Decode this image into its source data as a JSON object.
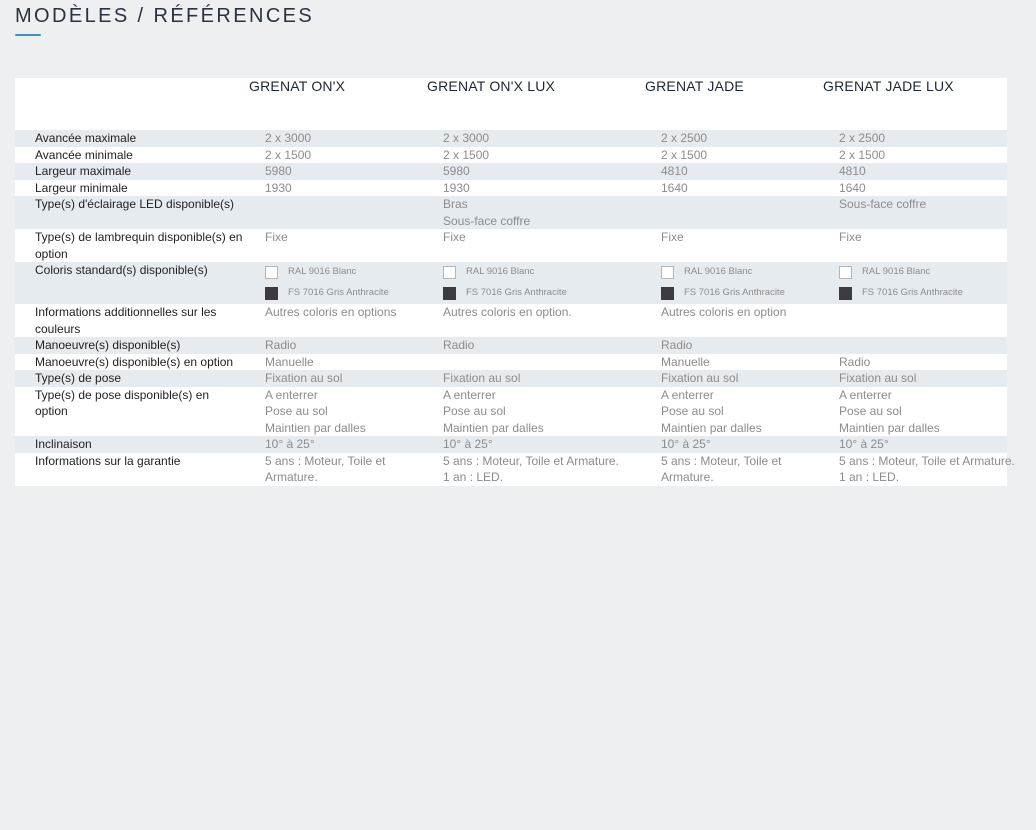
{
  "page": {
    "title": "MODÈLES / RÉFÉRENCES"
  },
  "table": {
    "headers": [
      "",
      "GRENAT ON'X",
      "GRENAT ON'X LUX",
      "GRENAT JADE",
      "GRENAT JADE LUX"
    ],
    "rows": [
      {
        "label": "Avancée maximale",
        "values": [
          [
            "2 x 3000"
          ],
          [
            "2 x 3000"
          ],
          [
            "2 x 2500"
          ],
          [
            "2 x 2500"
          ]
        ]
      },
      {
        "label": "Avancée minimale",
        "values": [
          [
            "2 x 1500"
          ],
          [
            "2 x 1500"
          ],
          [
            "2 x 1500"
          ],
          [
            "2 x 1500"
          ]
        ]
      },
      {
        "label": "Largeur maximale",
        "values": [
          [
            "5980"
          ],
          [
            "5980"
          ],
          [
            "4810"
          ],
          [
            "4810"
          ]
        ]
      },
      {
        "label": "Largeur minimale",
        "values": [
          [
            "1930"
          ],
          [
            "1930"
          ],
          [
            "1640"
          ],
          [
            "1640"
          ]
        ]
      },
      {
        "label": "Type(s) d'éclairage LED disponible(s)",
        "values": [
          [],
          [
            "Bras",
            "Sous-face coffre"
          ],
          [],
          [
            "Sous-face coffre"
          ]
        ]
      },
      {
        "label": "Type(s) de lambrequin disponible(s) en option",
        "values": [
          [
            "Fixe"
          ],
          [
            "Fixe"
          ],
          [
            "Fixe"
          ],
          [
            "Fixe"
          ]
        ]
      },
      {
        "label": "Coloris standard(s) disponible(s)",
        "type": "colors",
        "colors": [
          [
            {
              "name": "RAL 9016 Blanc",
              "swatch": "#ffffff"
            },
            {
              "name": "FS 7016 Gris Anthracite",
              "swatch": "#3a3c40"
            }
          ],
          [
            {
              "name": "RAL 9016 Blanc",
              "swatch": "#ffffff"
            },
            {
              "name": "FS 7016 Gris Anthracite",
              "swatch": "#3a3c40"
            }
          ],
          [
            {
              "name": "RAL 9016 Blanc",
              "swatch": "#ffffff"
            },
            {
              "name": "FS 7016 Gris Anthracite",
              "swatch": "#3a3c40"
            }
          ],
          [
            {
              "name": "RAL 9016 Blanc",
              "swatch": "#ffffff"
            },
            {
              "name": "FS 7016 Gris Anthracite",
              "swatch": "#3a3c40"
            }
          ]
        ]
      },
      {
        "label": "Informations additionnelles sur les couleurs",
        "values": [
          [
            "Autres coloris en options"
          ],
          [
            "Autres coloris en option."
          ],
          [
            "Autres coloris en option"
          ],
          []
        ]
      },
      {
        "label": "Manoeuvre(s) disponible(s)",
        "values": [
          [
            "Radio"
          ],
          [
            "Radio"
          ],
          [
            "Radio"
          ],
          []
        ]
      },
      {
        "label": "Manoeuvre(s) disponible(s) en option",
        "values": [
          [
            "Manuelle"
          ],
          [],
          [
            "Manuelle"
          ],
          [
            "Radio"
          ]
        ]
      },
      {
        "label": "Type(s) de pose",
        "values": [
          [
            "Fixation au sol"
          ],
          [
            "Fixation au sol"
          ],
          [
            "Fixation au sol"
          ],
          [
            "Fixation au sol"
          ]
        ]
      },
      {
        "label": "Type(s) de pose disponible(s) en option",
        "values": [
          [
            "A enterrer",
            "Pose au sol",
            "Maintien par dalles"
          ],
          [
            "A enterrer",
            "Pose au sol",
            "Maintien par dalles"
          ],
          [
            "A enterrer",
            "Pose au sol",
            "Maintien par dalles"
          ],
          [
            "A enterrer",
            "Pose au sol",
            "Maintien par dalles"
          ]
        ]
      },
      {
        "label": "Inclinaison",
        "values": [
          [
            "10° à 25°"
          ],
          [
            "10° à 25°"
          ],
          [
            "10° à 25°"
          ],
          [
            "10° à 25°"
          ]
        ]
      },
      {
        "label": "Informations sur la garantie",
        "values": [
          [
            "5 ans : Moteur, Toile et",
            "Armature."
          ],
          [
            "5 ans : Moteur, Toile et Armature.",
            "1 an : LED."
          ],
          [
            "5 ans : Moteur, Toile et",
            "Armature."
          ],
          [
            "5 ans : Moteur, Toile et Armature.",
            "1 an : LED."
          ]
        ]
      }
    ]
  },
  "colors": {
    "accent": "#3b93b8",
    "row_alt": "#e6ebf0",
    "background": "#eeeff1"
  }
}
